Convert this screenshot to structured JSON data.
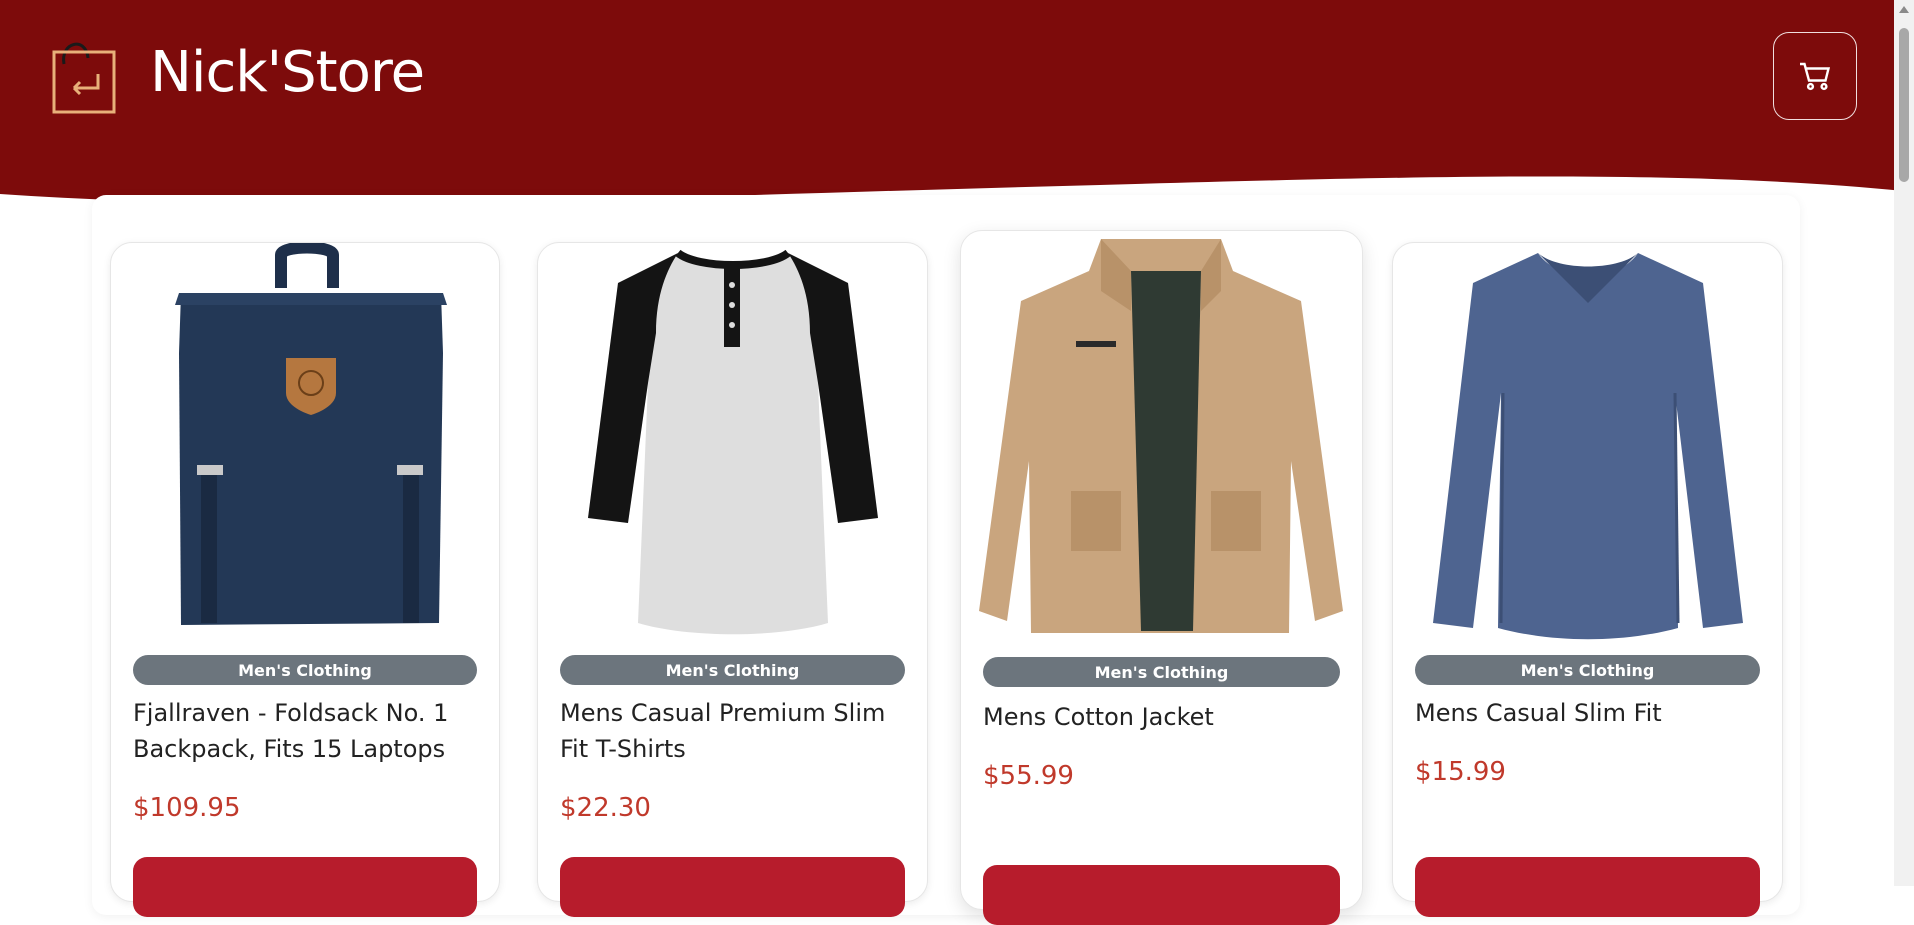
{
  "header": {
    "brand": "Nick'Store",
    "background_color": "#7d0b0b",
    "logo_icon": "shopping-bag-return-icon",
    "cart_icon": "cart-icon"
  },
  "products": [
    {
      "category": "Men's Clothing",
      "title": "Fjallraven - Foldsack No. 1 Backpack, Fits 15 Laptops",
      "price": "$109.95",
      "image": "navy-backpack"
    },
    {
      "category": "Men's Clothing",
      "title": "Mens Casual Premium Slim Fit T-Shirts",
      "price": "$22.30",
      "image": "raglan-henley-tshirt"
    },
    {
      "category": "Men's Clothing",
      "title": "Mens Cotton Jacket",
      "price": "$55.99",
      "image": "khaki-cotton-jacket"
    },
    {
      "category": "Men's Clothing",
      "title": "Mens Casual Slim Fit",
      "price": "$15.99",
      "image": "blue-long-sleeve-shirt"
    }
  ],
  "colors": {
    "accent_button": "#b71c2c",
    "price": "#c0392b",
    "badge": "#6c757d"
  }
}
